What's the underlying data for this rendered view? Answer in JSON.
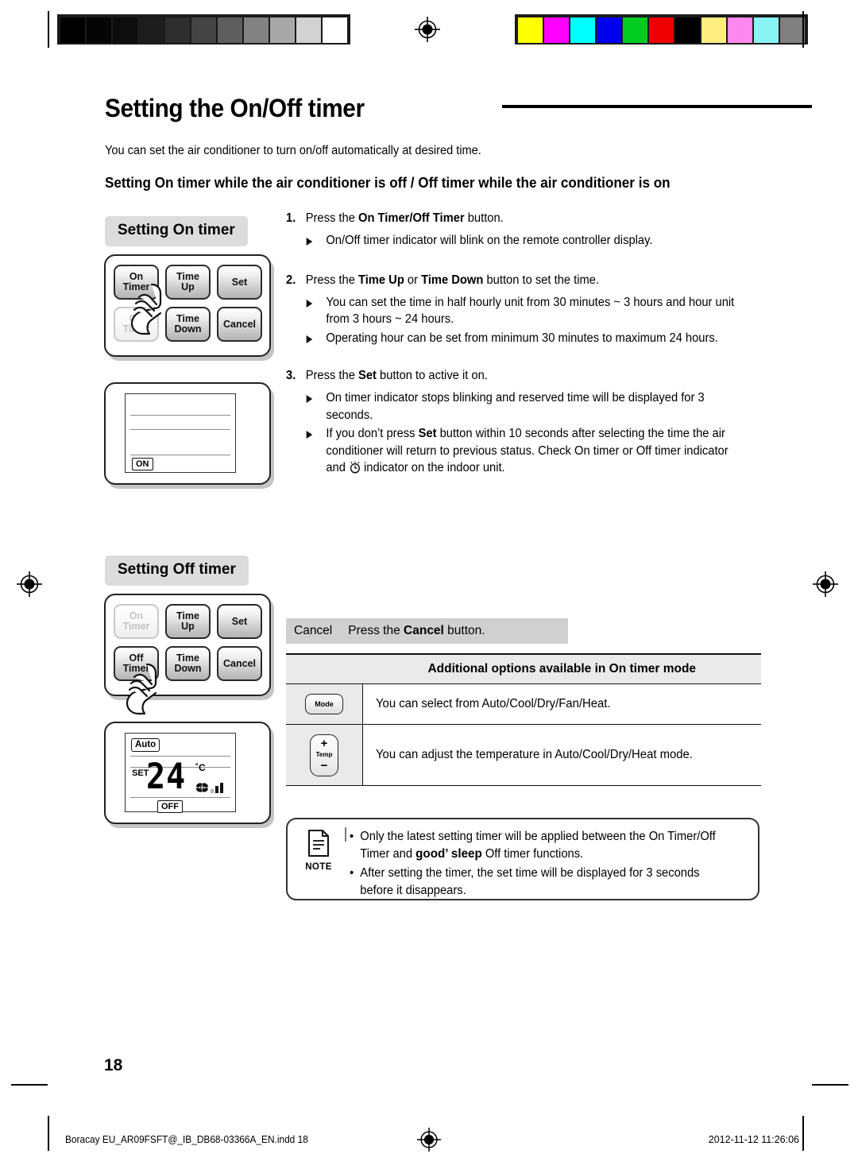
{
  "document": {
    "title": "Setting the On/Off timer",
    "intro": "You can set the air conditioner to turn on/off automatically at desired time.",
    "subheading": "Setting On timer while the air conditioner is off / Off timer while the air conditioner is on",
    "page_number": "18"
  },
  "sections": {
    "on_timer_label": "Setting On timer",
    "off_timer_label": "Setting Off timer"
  },
  "remote": {
    "buttons": {
      "on_timer_line1": "On",
      "on_timer_line2": "Timer",
      "time_up_line1": "Time",
      "time_up_line2": "Up",
      "set": "Set",
      "off_timer_line1": "Off",
      "off_timer_line2": "Timer",
      "time_down_line1": "Time",
      "time_down_line2": "Down",
      "cancel": "Cancel"
    }
  },
  "lcd_on": {
    "indicator": "ON"
  },
  "lcd_off": {
    "mode": "Auto",
    "set_label": "SET",
    "temperature": "24",
    "degree": "˚C",
    "indicator": "OFF"
  },
  "steps": [
    {
      "number": "1.",
      "title_plain": "Press the ",
      "title_bold": "On Timer/Off Timer",
      "title_tail": " button.",
      "bullets": [
        "On/Off timer indicator will blink on the remote controller display."
      ]
    },
    {
      "number": "2.",
      "title_plain": "Press the ",
      "title_bold": "Time Up",
      "title_mid": " or ",
      "title_bold2": "Time Down",
      "title_tail": " button to set the time.",
      "bullets": [
        "You can set the time in half hourly unit from 30 minutes ~ 3 hours and hour unit from 3 hours ~ 24 hours.",
        "Operating hour can be set from minimum 30 minutes to maximum 24 hours."
      ]
    },
    {
      "number": "3.",
      "title_plain": "Press the ",
      "title_bold": "Set",
      "title_tail": " button to active it on.",
      "bullets": [
        "On timer indicator stops blinking and reserved time will be displayed for 3 seconds."
      ],
      "bullet_rich": {
        "part1": "If you don’t press ",
        "bold": "Set",
        "part2": " button within 10 seconds after selecting the time the air conditioner will return to previous status. Check On timer or Off timer indicator and ",
        "part3": "indicator on the indoor unit."
      }
    }
  ],
  "cancel_band": {
    "label": "Cancel",
    "text_plain": "Press the ",
    "text_bold": "Cancel",
    "text_tail": " button."
  },
  "options_table": {
    "header": "Additional options available in On timer mode",
    "rows": [
      {
        "icon_label": "Mode",
        "description": "You can select from Auto/Cool/Dry/Fan/Heat."
      },
      {
        "icon_plus": "+",
        "icon_label": "Temp",
        "icon_minus": "−",
        "description": "You can adjust the temperature in Auto/Cool/Dry/Heat mode."
      }
    ]
  },
  "note": {
    "caption": "NOTE",
    "items": [
      {
        "part1": "Only the latest setting timer will be applied between the On Timer/Off Timer and ",
        "bold": "good’ sleep",
        "part2": " Off timer functions."
      },
      {
        "plain": "After setting the timer, the set time will be displayed for 3 seconds before it disappears."
      }
    ]
  },
  "footer": {
    "file": "Boracay EU_AR09FSFT@_IB_DB68-03366A_EN.indd   18",
    "timestamp": "2012-11-12   11:26:06"
  },
  "calibration": {
    "grey_ramp": [
      "#000000",
      "#050505",
      "#0d0d0d",
      "#1c1c1c",
      "#2e2e2e",
      "#444444",
      "#5e5e5e",
      "#828282",
      "#a8a8a8",
      "#d2d2d2",
      "#ffffff"
    ],
    "color_ramp": [
      "#ffff00",
      "#ff00ff",
      "#00ffff",
      "#0000ee",
      "#00cc22",
      "#ee0000",
      "#000000",
      "#ffef80",
      "#ff88ee",
      "#88f4f4",
      "#808080"
    ]
  }
}
